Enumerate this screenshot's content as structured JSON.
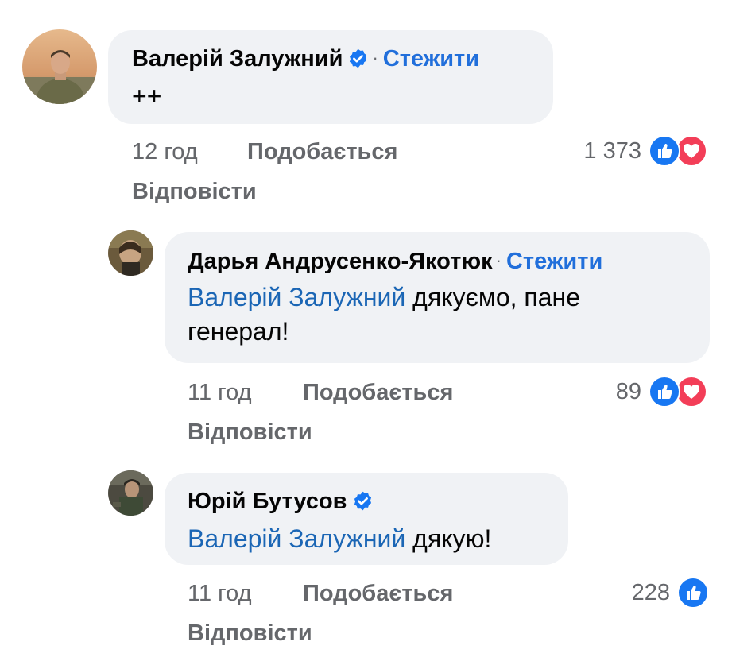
{
  "comments": [
    {
      "author": "Валерій Залужний",
      "verified": true,
      "follow_label": "Стежити",
      "text": "++",
      "time": "12 год",
      "like_label": "Подобається",
      "reply_label": "Відповісти",
      "reaction_count": "1 373",
      "reactions": [
        "like-icon",
        "love-icon"
      ]
    },
    {
      "author": "Дарья Андрусенко-Якотюк",
      "verified": false,
      "follow_label": "Стежити",
      "mention": "Валерій Залужний",
      "text_line1": " дякуємо, пане",
      "text_line2": "генерал!",
      "time": "11 год",
      "like_label": "Подобається",
      "reply_label": "Відповісти",
      "reaction_count": "89",
      "reactions": [
        "like-icon",
        "love-icon"
      ]
    },
    {
      "author": "Юрій Бутусов",
      "verified": true,
      "mention": "Валерій Залужний",
      "text": " дякую!",
      "time": "11 год",
      "like_label": "Подобається",
      "reply_label": "Відповісти",
      "reaction_count": "228",
      "reactions": [
        "like-icon"
      ]
    }
  ],
  "colors": {
    "bubble": "#f0f2f5",
    "link_blue": "#216fdb",
    "mention_blue": "#1b66b5",
    "meta_gray": "#65676b",
    "like_blue": "#1877f2",
    "love_red": "#f33e58"
  }
}
